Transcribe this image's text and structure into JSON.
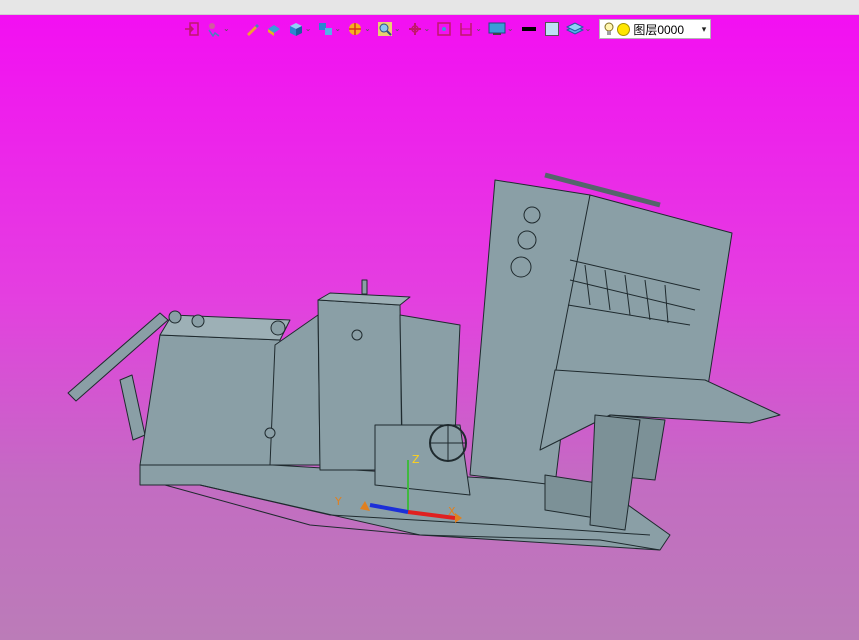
{
  "window": {
    "titlebar_color": "#e6e6e6"
  },
  "viewport": {
    "background_gradient": [
      "#f30ff2",
      "#e43fe0",
      "#c36cc2",
      "#bb7cb8"
    ],
    "model_fill": "#8a9fa6",
    "model_stroke": "#1f2a2e"
  },
  "toolbar": {
    "buttons": [
      {
        "icon": "exit-view-icon"
      },
      {
        "icon": "select-filter-icon",
        "dropdown": true
      },
      {
        "icon": "brush-icon"
      },
      {
        "icon": "layer-box-icon"
      },
      {
        "icon": "cube-view-icon",
        "dropdown": true
      },
      {
        "icon": "multi-view-icon",
        "dropdown": true
      },
      {
        "icon": "render-mode-icon",
        "dropdown": true
      },
      {
        "icon": "zoom-icon",
        "dropdown": true
      },
      {
        "icon": "rotate-icon",
        "dropdown": true
      },
      {
        "icon": "fit-view-icon"
      },
      {
        "icon": "section-view-icon",
        "dropdown": true
      },
      {
        "icon": "display-settings-icon",
        "dropdown": true
      },
      {
        "icon": "line-color-icon"
      },
      {
        "icon": "fill-color-icon"
      },
      {
        "icon": "layer-stack-icon",
        "dropdown": true
      }
    ],
    "layer_select": {
      "value": "图层0000"
    }
  },
  "axes": {
    "x": "X",
    "y": "Y",
    "z": "Z"
  }
}
